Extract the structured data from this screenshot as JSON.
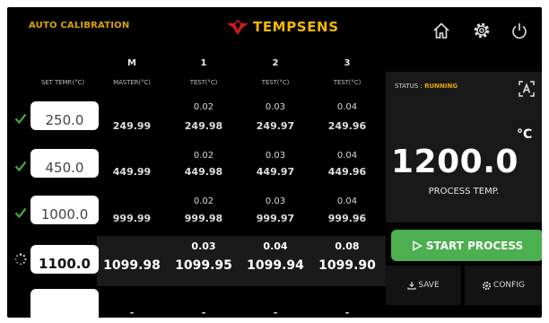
{
  "header": {
    "title": "AUTO CALIBRATION",
    "brand": "TEMPSENS"
  },
  "table": {
    "col_heads": [
      "M",
      "1",
      "2",
      "3"
    ],
    "sub_heads": [
      "SET TEMP.(°C)",
      "MASTER(°C)",
      "TEST(°C)",
      "TEST(°C)",
      "TEST(°C)"
    ],
    "rows": [
      {
        "set": "250.0",
        "status": "done",
        "dev": [
          "0.02",
          "0.03",
          "0.04"
        ],
        "vals": [
          "249.99",
          "249.98",
          "249.97",
          "249.96"
        ]
      },
      {
        "set": "450.0",
        "status": "done",
        "dev": [
          "0.02",
          "0.03",
          "0.04"
        ],
        "vals": [
          "449.99",
          "449.98",
          "449.97",
          "449.96"
        ]
      },
      {
        "set": "1000.0",
        "status": "done",
        "dev": [
          "0.02",
          "0.03",
          "0.04"
        ],
        "vals": [
          "999.99",
          "999.98",
          "999.97",
          "999.96"
        ]
      },
      {
        "set": "1100.0",
        "status": "in-progress",
        "dev": [
          "0.03",
          "0.04",
          "0.08"
        ],
        "vals": [
          "1099.98",
          "1099.95",
          "1099.94",
          "1099.90"
        ]
      },
      {
        "set": "",
        "status": "pending",
        "dev": [
          "",
          "",
          ""
        ],
        "vals": [
          "-",
          "-",
          "-",
          "-"
        ]
      }
    ]
  },
  "panel": {
    "status_label": "STATUS :",
    "status_value": "RUNNING",
    "temperature": "1200.0",
    "unit": "°C",
    "caption": "PROCESS TEMP."
  },
  "actions": {
    "start": "START PROCESS",
    "save": "SAVE",
    "config": "CONFIG"
  },
  "colors": {
    "accent": "#f2b800",
    "status": "#e8a400",
    "start": "#4caf50",
    "check": "#3fb13f"
  }
}
